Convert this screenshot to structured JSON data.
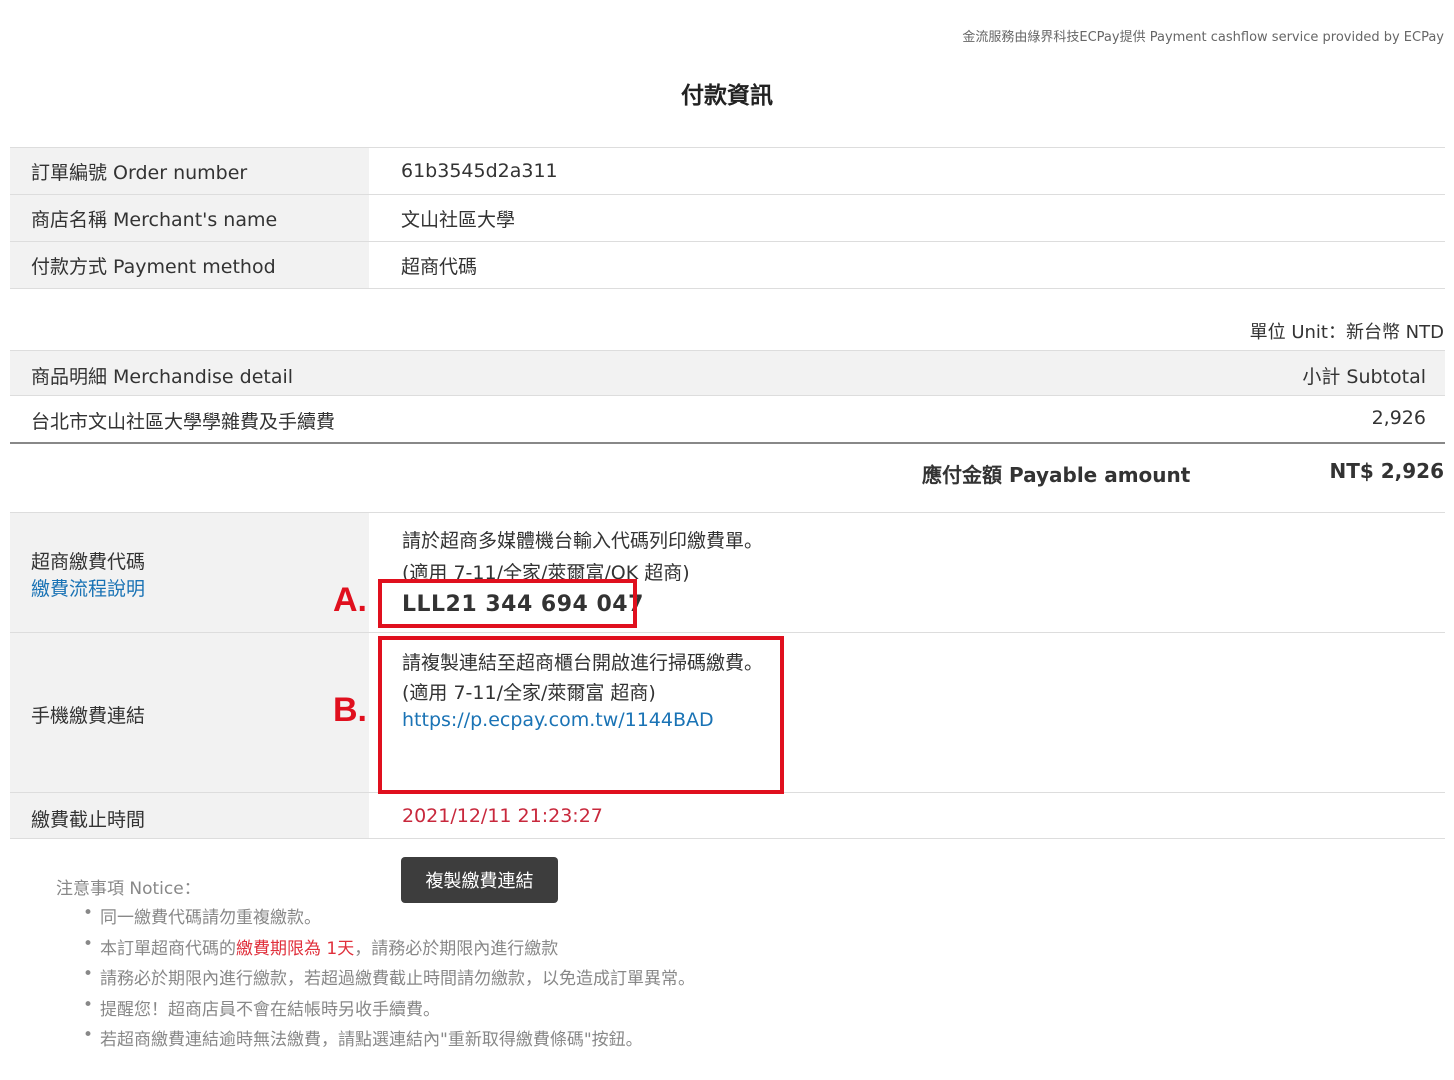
{
  "header": {
    "provider": "金流服務由綠界科技ECPay提供 Payment cashflow service provided by ECPay",
    "title": "付款資訊"
  },
  "order_info": [
    {
      "label": "訂單編號 Order number",
      "value": "61b3545d2a311"
    },
    {
      "label": "商店名稱 Merchant's name",
      "value": "文山社區大學"
    },
    {
      "label": "付款方式 Payment method",
      "value": "超商代碼"
    }
  ],
  "unit": "單位 Unit：新台幣 NTD",
  "merchandise": {
    "header_label": "商品明細 Merchandise detail",
    "header_subtotal": "小計 Subtotal",
    "item_name": "台北市文山社區大學學雜費及手續費",
    "item_amount": "2,926"
  },
  "payable": {
    "label": "應付金額 Payable amount",
    "value": "NT$ 2,926"
  },
  "payment_code": {
    "label": "超商繳費代碼",
    "help_link": "繳費流程說明",
    "instruction": "請於超商多媒體機台輸入代碼列印繳費單。",
    "stores": "(適用 7-11/全家/萊爾富/OK 超商)",
    "code": "LLL21 344 694 047"
  },
  "mobile_link": {
    "label": "手機繳費連結",
    "instruction": "請複製連結至超商櫃台開啟進行掃碼繳費。",
    "stores": "(適用 7-11/全家/萊爾富 超商)",
    "url": "https://p.ecpay.com.tw/1144BAD",
    "copy_button": "複製繳費連結"
  },
  "deadline": {
    "label": "繳費截止時間",
    "value": "2021/12/11 21:23:27"
  },
  "annotations": {
    "a": "A.",
    "b": "B.",
    "color": "#e0101e"
  },
  "notice": {
    "title": "注意事項 Notice：",
    "items": [
      "同一繳費代碼請勿重複繳款。",
      "本訂單超商代碼的",
      "請務必於期限內進行繳款，若超過繳費截止時間請勿繳款，以免造成訂單異常。",
      "提醒您！超商店員不會在結帳時另收手續費。",
      "若超商繳費連結逾時無法繳費，請點選連結內\"重新取得繳費條碼\"按鈕。"
    ],
    "item2_highlight": "繳費期限為 1天",
    "item2_rest": "，請務必於期限內進行繳款"
  },
  "colors": {
    "link": "#1a73b5",
    "deadline": "#c8283c",
    "button_bg": "#3d3d3d",
    "label_bg": "#f2f2f2"
  }
}
